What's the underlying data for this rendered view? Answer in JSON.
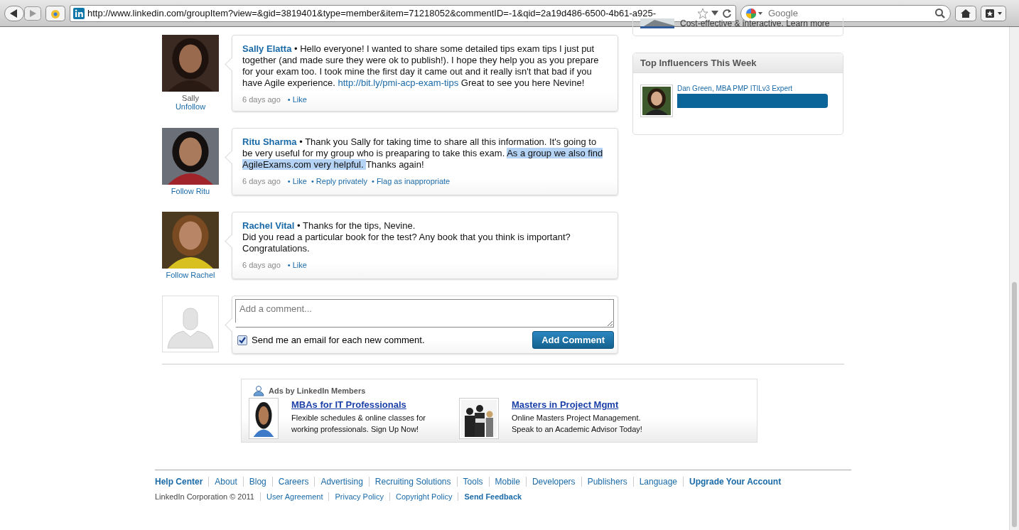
{
  "toolbar": {
    "url": "http://www.linkedin.com/groupItem?view=&gid=3819401&type=member&item=71218052&commentID=-1&qid=2a19d486-6500-4b61-a925-",
    "search": {
      "placeholder": "Google"
    }
  },
  "comments": [
    {
      "caption": "Sally",
      "follow": "Unfollow",
      "author": "Sally Elatta",
      "parts": [
        {
          "kind": "text",
          "text": "• Hello everyone! I wanted to share some detailed tips exam tips I just put together (and made sure they were ok to publish!). I hope they help you as you prepare for your exam too. I took mine the first day it came out and it really isn't that bad if you have Agile experience. ",
          "highlighted": false
        },
        {
          "kind": "link",
          "text": "http://bit.ly/pmi-acp-exam-tips",
          "highlighted": false
        },
        {
          "kind": "text",
          "text": " Great to see you here Nevine!",
          "highlighted": false
        }
      ],
      "time": "6 days ago",
      "actions": [
        "• Like"
      ]
    },
    {
      "follow": "Follow Ritu",
      "author": "Ritu Sharma",
      "parts": [
        {
          "kind": "text",
          "text": "• Thank you Sally for taking time to share all this information. It's going to be very useful for my group who is preaparing to take this exam. ",
          "highlighted": false
        },
        {
          "kind": "text",
          "text": "As a group we also find AgileExams.com very helpful. ",
          "highlighted": true
        },
        {
          "kind": "text",
          "text": "Thanks again!",
          "highlighted": false
        }
      ],
      "time": "6 days ago",
      "actions": [
        "• Like",
        "• Reply privately",
        "• Flag as inappropriate"
      ]
    },
    {
      "follow": "Follow Rachel",
      "author": "Rachel Vital",
      "parts": [
        {
          "kind": "text",
          "text": "• Thanks for the tips, Nevine.\nDid you read a particular book for the test? Any book that you think is important? Congratulations.",
          "highlighted": false
        }
      ],
      "time": "6 days ago",
      "actions": [
        "• Like"
      ]
    }
  ],
  "add_comment": {
    "placeholder": "Add a comment...",
    "email_option": {
      "label": "Send me an email for each new comment.",
      "checked": true
    },
    "button": "Add Comment"
  },
  "ads": {
    "title": "Ads by LinkedIn Members",
    "items": [
      {
        "headline": "MBAs for IT Professionals",
        "text": "Flexible schedules & online classes for working professionals. Sign Up Now!"
      },
      {
        "headline": "Masters in Project Mgmt",
        "text": "Online Masters Project Management. Speak to an Academic Advisor Today!"
      }
    ]
  },
  "sidebar": {
    "promo_text": "Cost-effective & interactive. Learn more",
    "influencers": {
      "title": "Top Influencers This Week",
      "items": [
        {
          "name": "Dan Green, MBA PMP ITILv3 Expert"
        }
      ]
    }
  },
  "footer": {
    "links": [
      {
        "label": "Help Center",
        "bold": true
      },
      {
        "label": "About",
        "bold": false
      },
      {
        "label": "Blog",
        "bold": false
      },
      {
        "label": "Careers",
        "bold": false
      },
      {
        "label": "Advertising",
        "bold": false
      },
      {
        "label": "Recruiting Solutions",
        "bold": false
      },
      {
        "label": "Tools",
        "bold": false
      },
      {
        "label": "Mobile",
        "bold": false
      },
      {
        "label": "Developers",
        "bold": false
      },
      {
        "label": "Publishers",
        "bold": false
      },
      {
        "label": "Language",
        "bold": false
      },
      {
        "label": "Upgrade Your Account",
        "bold": true
      }
    ],
    "copyright": "LinkedIn Corporation © 2011",
    "legal": [
      {
        "label": "User Agreement",
        "bold": false
      },
      {
        "label": "Privacy Policy",
        "bold": false
      },
      {
        "label": "Copyright Policy",
        "bold": false
      },
      {
        "label": "Send Feedback",
        "bold": true
      }
    ]
  }
}
